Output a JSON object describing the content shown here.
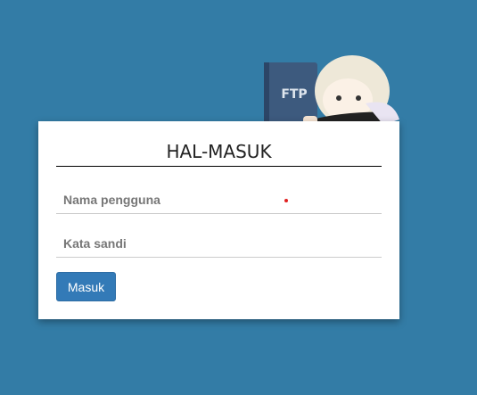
{
  "login": {
    "title": "HAL-MASUK",
    "username_placeholder": "Nama pengguna",
    "password_placeholder": "Kata sandi",
    "submit_label": "Masuk",
    "mascot_book_text": "FTP"
  },
  "colors": {
    "background": "#337ca6",
    "button": "#337ab7"
  }
}
